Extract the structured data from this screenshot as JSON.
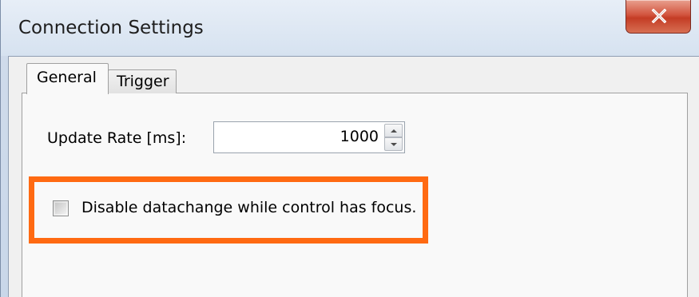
{
  "window": {
    "title": "Connection Settings"
  },
  "tabs": [
    {
      "label": "General",
      "selected": true
    },
    {
      "label": "Trigger",
      "selected": false
    }
  ],
  "general": {
    "update_rate_label": "Update Rate [ms]:",
    "update_rate_value": "1000",
    "disable_datachange_label": "Disable datachange while control has focus.",
    "disable_datachange_checked": false
  },
  "colors": {
    "highlight": "#ff6a12",
    "close_button": "#c43c25"
  },
  "icons": {
    "close": "close-icon",
    "spin_up": "chevron-up-icon",
    "spin_down": "chevron-down-icon"
  }
}
